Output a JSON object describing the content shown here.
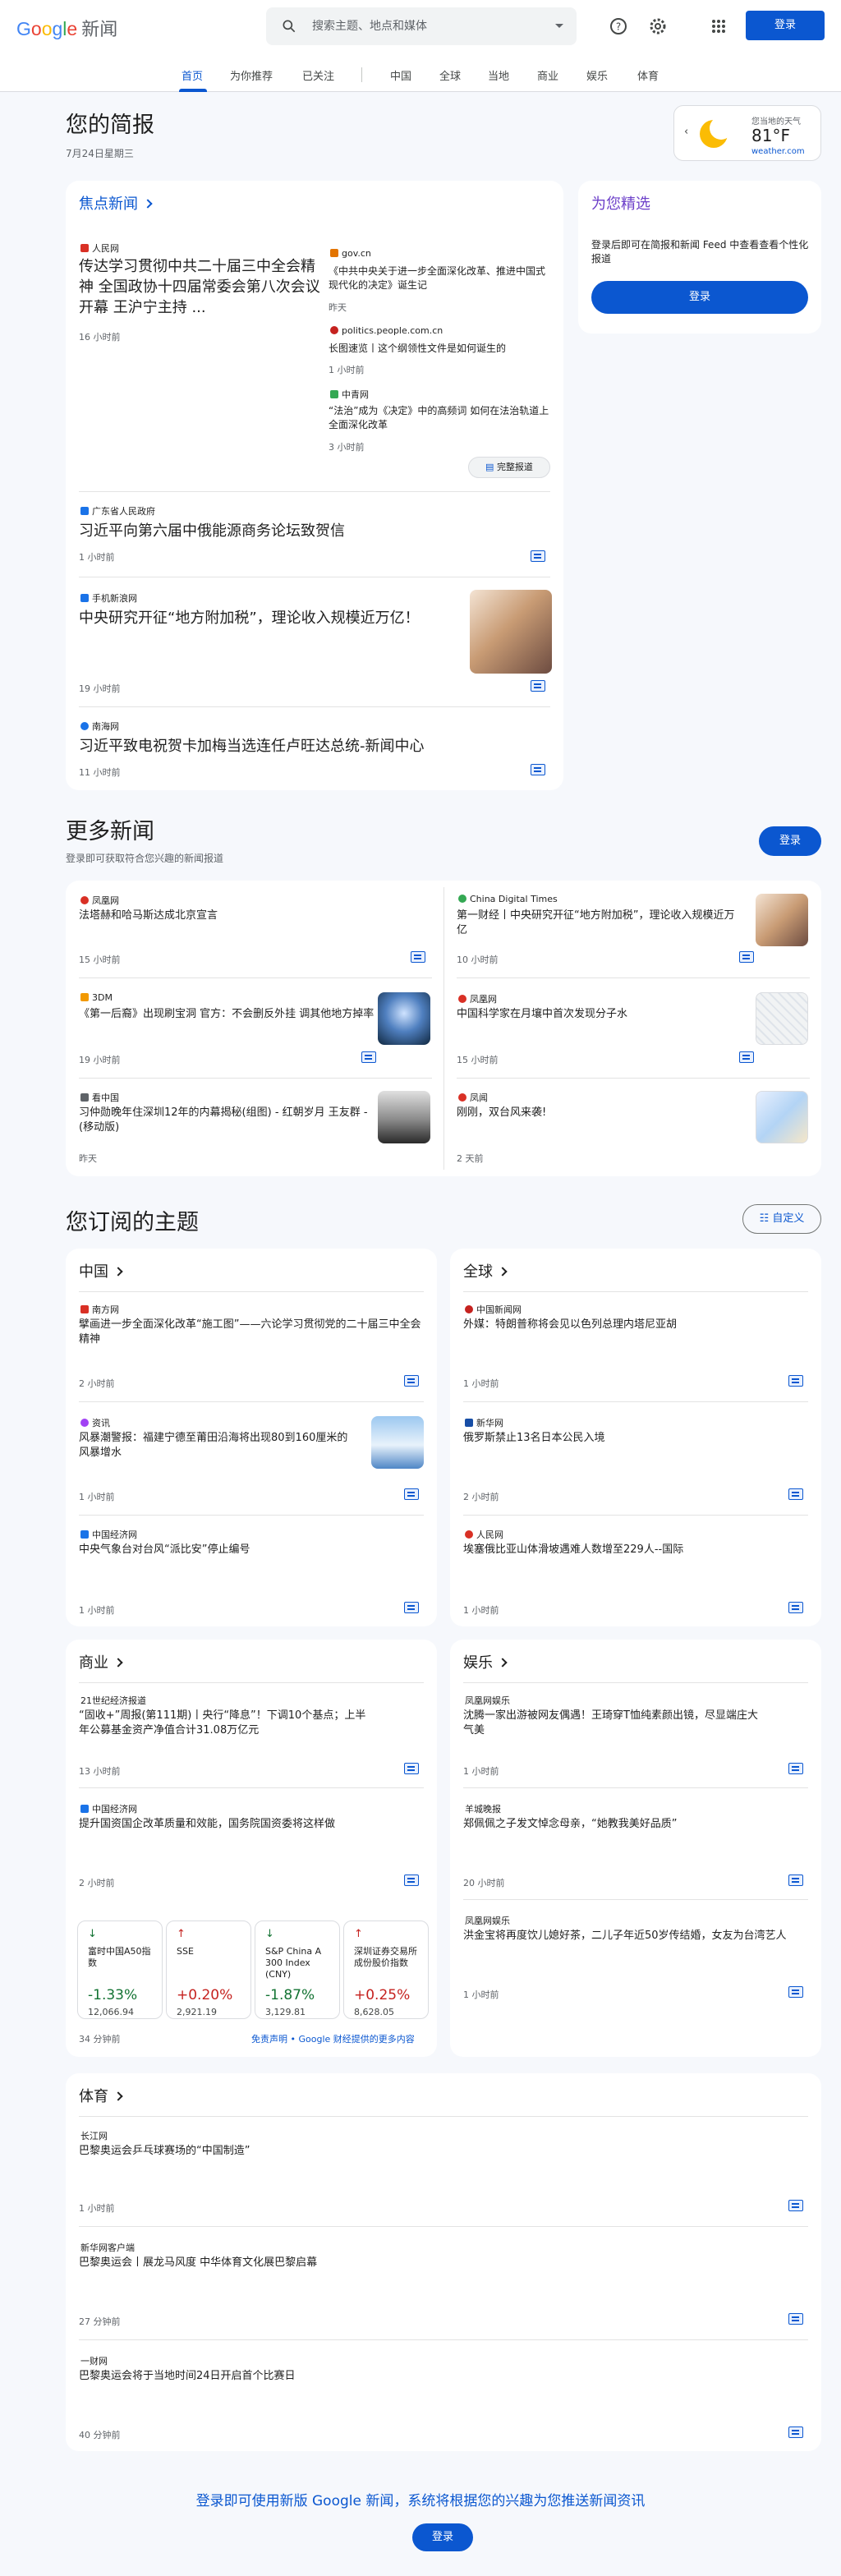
{
  "header": {
    "logo_google": "Google",
    "logo_news": "新闻",
    "search_placeholder": "搜索主题、地点和媒体",
    "signin": "登录"
  },
  "tabs": [
    "首页",
    "为你推荐",
    "已关注",
    "中国",
    "全球",
    "当地",
    "商业",
    "娱乐",
    "体育"
  ],
  "briefing": {
    "title": "您的简报",
    "date": "7月24日星期三"
  },
  "weather": {
    "label": "您当地的天气",
    "temp": "81°F",
    "source": "weather.com"
  },
  "top": {
    "title": "焦点新闻",
    "main": {
      "source": "人民网",
      "title": "传达学习贯彻中共二十届三中全会精神 全国政协十四届常委会第八次会议开幕 王沪宁主持 ...",
      "time": "16 小时前"
    },
    "side": [
      {
        "source": "gov.cn",
        "title": "《中共中央关于进一步全面深化改革、推进中国式现代化的决定》诞生记",
        "time": "昨天"
      },
      {
        "source": "politics.people.com.cn",
        "title": "长图速览丨这个纲领性文件是如何诞生的",
        "time": "1 小时前"
      },
      {
        "source": "中青网",
        "title": "“法治”成为《决定》中的高频词 如何在法治轨道上全面深化改革",
        "time": "3 小时前"
      }
    ],
    "full_coverage": "完整报道",
    "stories": [
      {
        "source": "广东省人民政府",
        "title": "习近平向第六届中俄能源商务论坛致贺信",
        "time": "1 小时前"
      },
      {
        "source": "手机新浪网",
        "title": "中央研究开征“地方附加税”，理论收入规模近万亿！",
        "time": "19 小时前"
      },
      {
        "source": "南海网",
        "title": "习近平致电祝贺卡加梅当选连任卢旺达总统-新闻中心",
        "time": "11 小时前"
      }
    ]
  },
  "picks": {
    "title": "为您精选",
    "text": "登录后即可在简报和新闻 Feed 中查看查看个性化报道",
    "button": "登录"
  },
  "more": {
    "title": "更多新闻",
    "subtitle": "登录即可获取符合您兴趣的新闻报道",
    "button": "登录",
    "items": [
      {
        "source": "凤凰网",
        "title": "法塔赫和哈马斯达成北京宣言",
        "time": "15 小时前"
      },
      {
        "source": "China Digital Times",
        "title": "第一财经丨中央研究开征“地方附加税”，理论收入规模近万亿",
        "time": "10 小时前"
      },
      {
        "source": "3DM",
        "title": "《第一后裔》出现刷宝洞 官方：不会删反外挂 调其他地方掉率",
        "time": "19 小时前"
      },
      {
        "source": "凤凰网",
        "title": "中国科学家在月壤中首次发现分子水",
        "time": "15 小时前"
      },
      {
        "source": "看中国",
        "title": "习仲勋晚年住深圳12年的内幕揭秘(组图) - 红朝岁月 王友群 - (移动版)",
        "time": "昨天"
      },
      {
        "source": "凤闻",
        "title": "刚刚，双台风来袭!",
        "time": "2 天前"
      }
    ]
  },
  "topics": {
    "title": "您订阅的主题",
    "customize": "自定义",
    "china": {
      "title": "中国",
      "items": [
        {
          "source": "南方网",
          "title": "擘画进一步全面深化改革“施工图”——六论学习贯彻党的二十届三中全会精神",
          "time": "2 小时前"
        },
        {
          "source": "资讯",
          "title": "风暴潮警报：福建宁德至莆田沿海将出现80到160厘米的风暴增水",
          "time": "1 小时前"
        },
        {
          "source": "中国经济网",
          "title": "中央气象台对台风“派比安”停止编号",
          "time": "1 小时前"
        }
      ]
    },
    "world": {
      "title": "全球",
      "items": [
        {
          "source": "中国新闻网",
          "title": "外媒：特朗普称将会见以色列总理内塔尼亚胡",
          "time": "1 小时前"
        },
        {
          "source": "新华网",
          "title": "俄罗斯禁止13名日本公民入境",
          "time": "2 小时前"
        },
        {
          "source": "人民网",
          "title": "埃塞俄比亚山体滑坡遇难人数增至229人--国际",
          "time": "1 小时前"
        }
      ]
    },
    "business": {
      "title": "商业",
      "items": [
        {
          "source": "21世纪经济报道",
          "title": "“固收+”周报(第111期)丨央行“降息”！下调10个基点；上半年公募基金资产净值合计31.08万亿元",
          "time": "13 小时前"
        },
        {
          "source": "中国经济网",
          "title": "提升国资国企改革质量和效能，国务院国资委将这样做",
          "time": "2 小时前"
        }
      ],
      "stocks": [
        {
          "arrow": "↓",
          "name": "富时中国A50指数",
          "pct": "-1.33%",
          "value": "12,066.94",
          "up": false
        },
        {
          "arrow": "↑",
          "name": "SSE",
          "pct": "+0.20%",
          "value": "2,921.19",
          "up": true
        },
        {
          "arrow": "↓",
          "name": "S&P China A 300 Index (CNY)",
          "pct": "-1.87%",
          "value": "3,129.81",
          "up": false
        },
        {
          "arrow": "↑",
          "name": "深圳证券交易所成份股价指数",
          "pct": "+0.25%",
          "value": "8,628.05",
          "up": true
        }
      ],
      "stocks_time": "34 分钟前",
      "disclaimer": "免责声明 • Google 财经提供的更多内容"
    },
    "ent": {
      "title": "娱乐",
      "items": [
        {
          "source": "凤凰网娱乐",
          "title": "沈腾一家出游被网友偶遇！王琦穿T恤纯素颜出镜，尽显端庄大气美",
          "time": "1 小时前"
        },
        {
          "source": "羊城晚报",
          "title": "郑佩佩之子发文悼念母亲，“她教我美好品质”",
          "time": "20 小时前"
        },
        {
          "source": "凤凰网娱乐",
          "title": "洪金宝将再度饮儿媳好茶，二儿子年近50岁传结婚，女友为台湾艺人",
          "time": "1 小时前"
        }
      ]
    },
    "sports": {
      "title": "体育",
      "items": [
        {
          "source": "长江网",
          "title": "巴黎奥运会乒乓球赛场的“中国制造”",
          "time": "1 小时前"
        },
        {
          "source": "新华网客户端",
          "title": "巴黎奥运会丨展龙马风度 中华体育文化展巴黎启幕",
          "time": "27 分钟前"
        },
        {
          "source": "一财网",
          "title": "巴黎奥运会将于当地时间24日开启首个比赛日",
          "time": "40 分钟前"
        }
      ]
    }
  },
  "footer": {
    "text": "登录即可使用新版 Google 新闻，系统将根据您的兴趣为您推送新闻资讯",
    "button": "登录"
  },
  "colors": {
    "accent": "#0b57d0",
    "up": "#c5221f",
    "down": "#137333"
  }
}
